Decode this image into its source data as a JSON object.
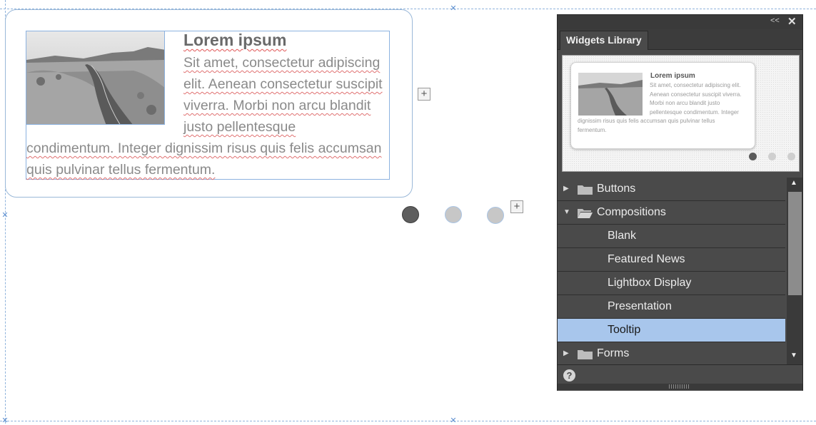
{
  "composition": {
    "title": "Lorem ipsum",
    "body": "Sit amet, consectetur adipiscing elit. Aenean consectetur suscipit viverra. Morbi non arcu blandit justo pellentesque condimentum. Integer dignissim risus quis felis accumsan quis pulvinar tellus fermentum.",
    "slide_count": 3,
    "active_slide": 1
  },
  "panel": {
    "collapse_glyph": "<<",
    "close_glyph": "✕",
    "tab_label": "Widgets Library",
    "preview": {
      "title": "Lorem ipsum",
      "body": "Sit amet, consectetur adipiscing elit. Aenean consectetur suscipit viverra. Morbi non arcu blandit justo pellentesque condimentum. Integer dignissim risus quis felis accumsan quis pulvinar tellus fermentum."
    },
    "tree": [
      {
        "label": "Buttons",
        "type": "folder",
        "expanded": false
      },
      {
        "label": "Compositions",
        "type": "folder",
        "expanded": true
      },
      {
        "label": "Blank",
        "type": "item"
      },
      {
        "label": "Featured News",
        "type": "item"
      },
      {
        "label": "Lightbox Display",
        "type": "item"
      },
      {
        "label": "Presentation",
        "type": "item"
      },
      {
        "label": "Tooltip",
        "type": "item",
        "selected": true
      },
      {
        "label": "Forms",
        "type": "folder",
        "expanded": false
      }
    ],
    "help_glyph": "?"
  },
  "colors": {
    "selection": "#a8c6ec",
    "panel_bg": "#4a4a4a",
    "guide": "#8fb3dc",
    "spellcheck": "#e05555"
  }
}
